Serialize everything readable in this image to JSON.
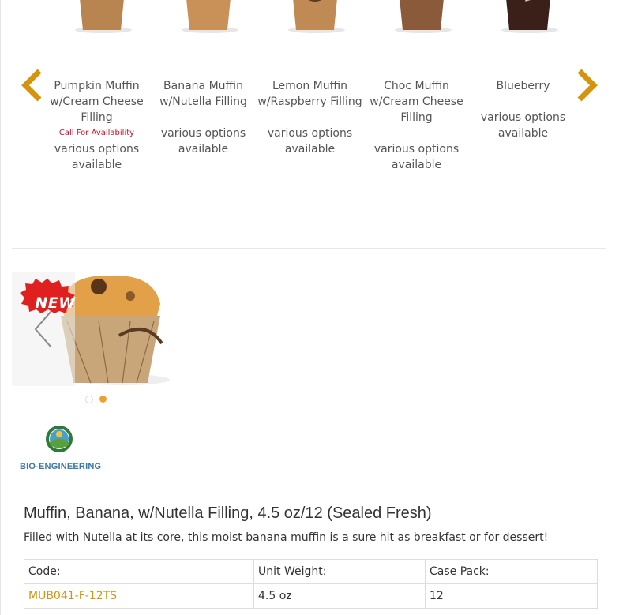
{
  "carousel": {
    "prev_icon": "chevron-left-icon",
    "next_icon": "chevron-right-icon",
    "accent_color": "#d4940e",
    "items": [
      {
        "name": "Pumpkin Muffin w/Cream Cheese Filling",
        "note": "Call For Availability",
        "options": "various options available"
      },
      {
        "name": "Banana Muffin w/Nutella Filling",
        "note": "",
        "options": "various options available"
      },
      {
        "name": "Lemon Muffin w/Raspberry Filling",
        "note": "",
        "options": "various options available"
      },
      {
        "name": "Choc Muffin w/Cream Cheese Filling",
        "note": "",
        "options": "various options available"
      },
      {
        "name": "Blueberry",
        "note": "",
        "options": "various options available"
      }
    ]
  },
  "gallery": {
    "badge": "NEW",
    "prev_icon": "chevron-left-icon",
    "active_slide": 2,
    "slide_count": 2
  },
  "bio": {
    "label": "BIO-ENGINEERING",
    "icon": "bioengineered-seal-icon"
  },
  "product": {
    "title": "Muffin, Banana, w/Nutella Filling, 4.5 oz/12 (Sealed Fresh)",
    "description": "Filled with Nutella at its core, this moist banana muffin is a sure hit as breakfast or for dessert!",
    "headers": {
      "code": "Code:",
      "unit_weight": "Unit Weight:",
      "case_pack": "Case Pack:"
    },
    "values": {
      "code": "MUB041-F-12TS",
      "unit_weight": "4.5 oz",
      "case_pack": "12"
    }
  }
}
